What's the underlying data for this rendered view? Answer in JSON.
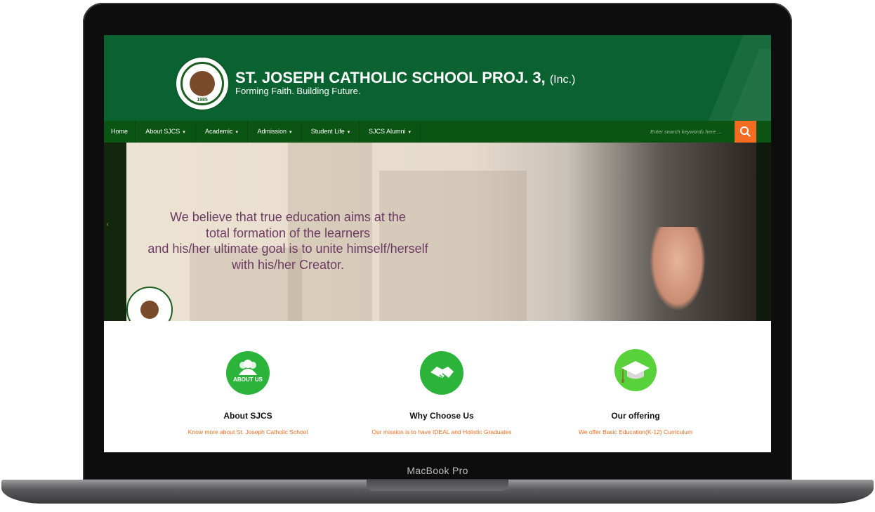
{
  "device": {
    "brand_label": "MacBook Pro"
  },
  "header": {
    "title": "ST. JOSEPH CATHOLIC SCHOOL PROJ. 3,",
    "title_suffix": "(Inc.)",
    "tagline": "Forming Faith. Building Future.",
    "logo_year": "1985",
    "logo_text": "ST. JOSEPH CATHOLIC SCHOOL"
  },
  "nav": {
    "items": [
      {
        "label": "Home",
        "has_dropdown": false
      },
      {
        "label": "About SJCS",
        "has_dropdown": true
      },
      {
        "label": "Academic",
        "has_dropdown": true
      },
      {
        "label": "Admission",
        "has_dropdown": true
      },
      {
        "label": "Student Life",
        "has_dropdown": true
      },
      {
        "label": "SJCS Alumni",
        "has_dropdown": true
      }
    ],
    "caret": "▾",
    "search_placeholder": "Enter search keywords here ...",
    "search_icon": "search-icon"
  },
  "hero": {
    "quote_lines": [
      "We believe that true education aims at the",
      "total formation of the learners",
      "and his/her ultimate goal is to unite himself/herself",
      "with his/her Creator."
    ],
    "prev_icon": "‹"
  },
  "features": [
    {
      "icon": "about-us-icon",
      "icon_text": "ABOUT US",
      "title": "About SJCS",
      "subtitle": "Know more about St. Joseph Catholic School"
    },
    {
      "icon": "handshake-icon",
      "title": "Why Choose Us",
      "subtitle": "Our mission is to have IDEAL and Holistic Graduates"
    },
    {
      "icon": "graduation-cap-icon",
      "title": "Our offering",
      "subtitle": "We offer Basic Education(K-12) Curriculum"
    }
  ],
  "colors": {
    "header_green": "#0a6230",
    "nav_green": "#0b5413",
    "accent_orange": "#f26d21",
    "quote_purple": "#6d3a63",
    "icon_green": "#2bb33a",
    "icon_lime": "#58d13a"
  }
}
